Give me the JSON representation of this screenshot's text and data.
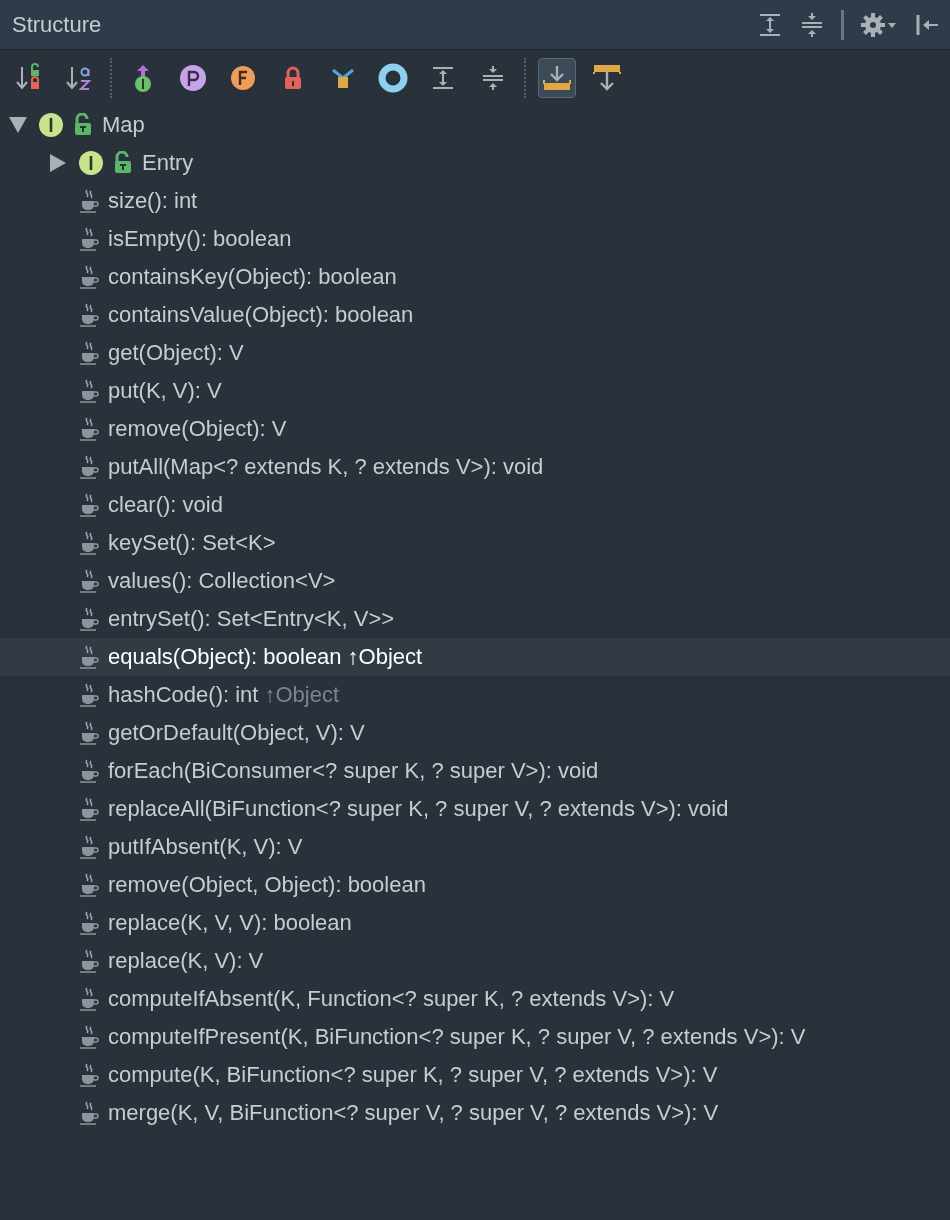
{
  "window": {
    "title": "Structure"
  },
  "header_actions": [
    {
      "kind": "expand"
    },
    {
      "kind": "collapse"
    },
    {
      "kind": "separator"
    },
    {
      "kind": "settings"
    },
    {
      "kind": "hide"
    }
  ],
  "toolbar": [
    {
      "kind": "sort-visibility",
      "selected": false
    },
    {
      "kind": "sort-alpha",
      "selected": false
    },
    {
      "kind": "separator"
    },
    {
      "kind": "inherited",
      "selected": false
    },
    {
      "kind": "property",
      "selected": false
    },
    {
      "kind": "field",
      "selected": false
    },
    {
      "kind": "lock",
      "selected": false
    },
    {
      "kind": "anonymous",
      "selected": false
    },
    {
      "kind": "ring",
      "selected": false
    },
    {
      "kind": "expand",
      "selected": false
    },
    {
      "kind": "collapse",
      "selected": false
    },
    {
      "kind": "separator"
    },
    {
      "kind": "scroll-to",
      "selected": true
    },
    {
      "kind": "scroll-from",
      "selected": false
    }
  ],
  "tree": [
    {
      "kind": "interface",
      "label": "Map",
      "expanded": true,
      "children": [
        {
          "kind": "interface",
          "label": "Entry",
          "expanded": false,
          "selected": false
        },
        {
          "kind": "method",
          "label": "size(): int",
          "selected": false
        },
        {
          "kind": "method",
          "label": "isEmpty(): boolean",
          "selected": false
        },
        {
          "kind": "method",
          "label": "containsKey(Object): boolean",
          "selected": false
        },
        {
          "kind": "method",
          "label": "containsValue(Object): boolean",
          "selected": false
        },
        {
          "kind": "method",
          "label": "get(Object): V",
          "selected": false
        },
        {
          "kind": "method",
          "label": "put(K, V): V",
          "selected": false
        },
        {
          "kind": "method",
          "label": "remove(Object): V",
          "selected": false
        },
        {
          "kind": "method",
          "label": "putAll(Map<? extends K, ? extends V>): void",
          "selected": false
        },
        {
          "kind": "method",
          "label": "clear(): void",
          "selected": false
        },
        {
          "kind": "method",
          "label": "keySet(): Set<K>",
          "selected": false
        },
        {
          "kind": "method",
          "label": "values(): Collection<V>",
          "selected": false
        },
        {
          "kind": "method",
          "label": "entrySet(): Set<Entry<K, V>>",
          "selected": false
        },
        {
          "kind": "method",
          "label": "equals(Object): boolean",
          "origin": "↑Object",
          "selected": true
        },
        {
          "kind": "method",
          "label": "hashCode(): int",
          "origin": "↑Object",
          "selected": false
        },
        {
          "kind": "method",
          "label": "getOrDefault(Object, V): V",
          "selected": false
        },
        {
          "kind": "method",
          "label": "forEach(BiConsumer<? super K, ? super V>): void",
          "selected": false
        },
        {
          "kind": "method",
          "label": "replaceAll(BiFunction<? super K, ? super V, ? extends V>): void",
          "selected": false
        },
        {
          "kind": "method",
          "label": "putIfAbsent(K, V): V",
          "selected": false
        },
        {
          "kind": "method",
          "label": "remove(Object, Object): boolean",
          "selected": false
        },
        {
          "kind": "method",
          "label": "replace(K, V, V): boolean",
          "selected": false
        },
        {
          "kind": "method",
          "label": "replace(K, V): V",
          "selected": false
        },
        {
          "kind": "method",
          "label": "computeIfAbsent(K, Function<? super K, ? extends V>): V",
          "selected": false
        },
        {
          "kind": "method",
          "label": "computeIfPresent(K, BiFunction<? super K, ? super V, ? extends V>): V",
          "selected": false
        },
        {
          "kind": "method",
          "label": "compute(K, BiFunction<? super K, ? super V, ? extends V>): V",
          "selected": false
        },
        {
          "kind": "method",
          "label": "merge(K, V, BiFunction<? super V, ? super V, ? extends V>): V",
          "selected": false
        }
      ]
    }
  ]
}
